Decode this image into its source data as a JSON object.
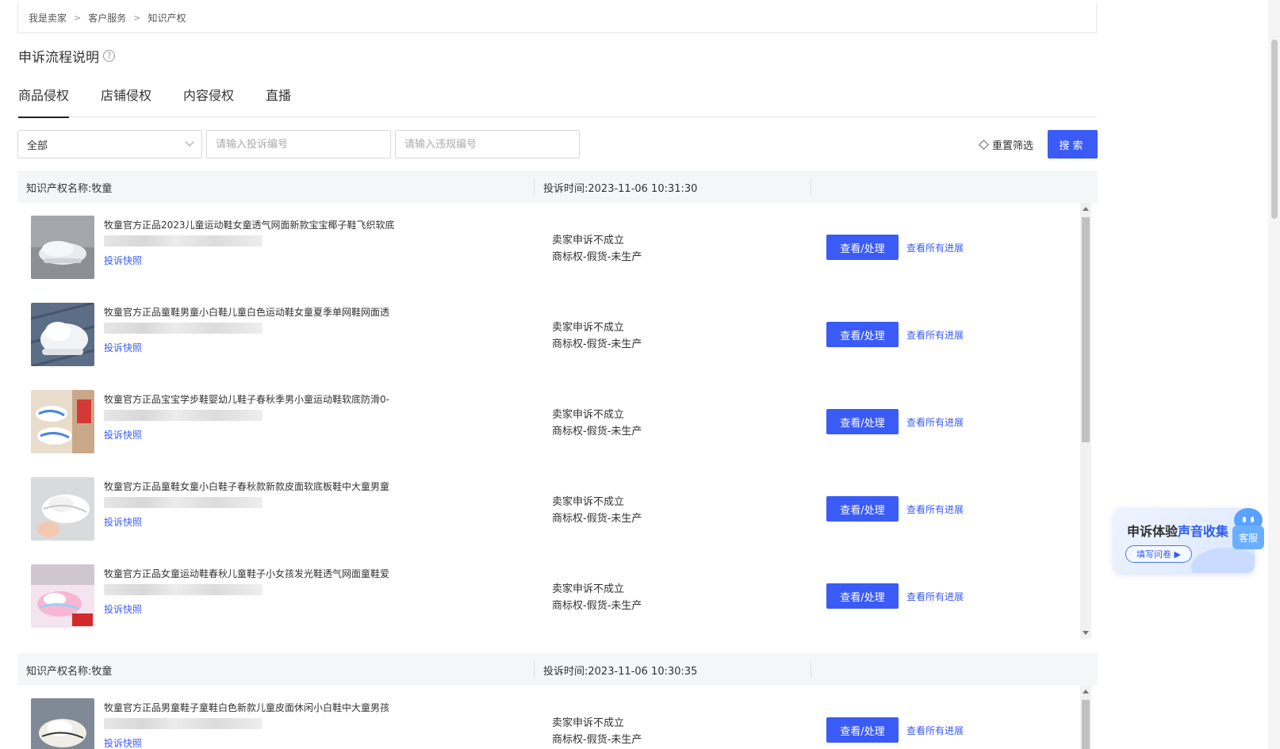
{
  "breadcrumb": [
    "我是卖家",
    "客户服务",
    "知识产权"
  ],
  "page_title": "申诉流程说明",
  "help_icon": "?",
  "tabs": [
    {
      "label": "商品侵权",
      "active": true
    },
    {
      "label": "店铺侵权",
      "active": false
    },
    {
      "label": "内容侵权",
      "active": false
    },
    {
      "label": "直播",
      "active": false
    }
  ],
  "filters": {
    "select_value": "全部",
    "complaint_no_placeholder": "请输入投诉编号",
    "violation_no_placeholder": "请输入违规编号",
    "reset_label": "重置筛选",
    "search_label": "搜索"
  },
  "groups": [
    {
      "ip_name": "知识产权名称:牧童",
      "time": "投诉时间:2023-11-06 10:31:30",
      "rows": [
        {
          "title": "牧童官方正品2023儿童运动鞋女童透气网面新款宝宝椰子鞋飞织软底",
          "snapshot": "投诉快照",
          "status_line1": "卖家申诉不成立",
          "status_line2": "商标权-假货-未生产",
          "action": "查看/处理",
          "progress": "查看所有进展"
        },
        {
          "title": "牧童官方正品童鞋男童小白鞋儿童白色运动鞋女童夏季单网鞋网面透",
          "snapshot": "投诉快照",
          "status_line1": "卖家申诉不成立",
          "status_line2": "商标权-假货-未生产",
          "action": "查看/处理",
          "progress": "查看所有进展"
        },
        {
          "title": "牧童官方正品宝宝学步鞋婴幼儿鞋子春秋季男小童运动鞋软底防滑0-",
          "snapshot": "投诉快照",
          "status_line1": "卖家申诉不成立",
          "status_line2": "商标权-假货-未生产",
          "action": "查看/处理",
          "progress": "查看所有进展"
        },
        {
          "title": "牧童官方正品童鞋女童小白鞋子春秋款新款皮面软底板鞋中大童男童",
          "snapshot": "投诉快照",
          "status_line1": "卖家申诉不成立",
          "status_line2": "商标权-假货-未生产",
          "action": "查看/处理",
          "progress": "查看所有进展"
        },
        {
          "title": "牧童官方正品女童运动鞋春秋儿童鞋子小女孩发光鞋透气网面童鞋爱",
          "snapshot": "投诉快照",
          "status_line1": "卖家申诉不成立",
          "status_line2": "商标权-假货-未生产",
          "action": "查看/处理",
          "progress": "查看所有进展"
        }
      ]
    },
    {
      "ip_name": "知识产权名称:牧童",
      "time": "投诉时间:2023-11-06 10:30:35",
      "rows": [
        {
          "title": "牧童官方正品男童鞋子童鞋白色新款儿童皮面休闲小白鞋中大童男孩",
          "snapshot": "投诉快照",
          "status_line1": "卖家申诉不成立",
          "status_line2": "商标权-假货-未生产",
          "action": "查看/处理",
          "progress": "查看所有进展"
        }
      ]
    }
  ],
  "survey": {
    "title_plain": "申诉体验",
    "title_highlight": "声音收集",
    "button": "填写问卷 ▶",
    "cs_label": "客服"
  },
  "colors": {
    "primary": "#3b5bf6",
    "header_bg": "#f5f6f7"
  }
}
